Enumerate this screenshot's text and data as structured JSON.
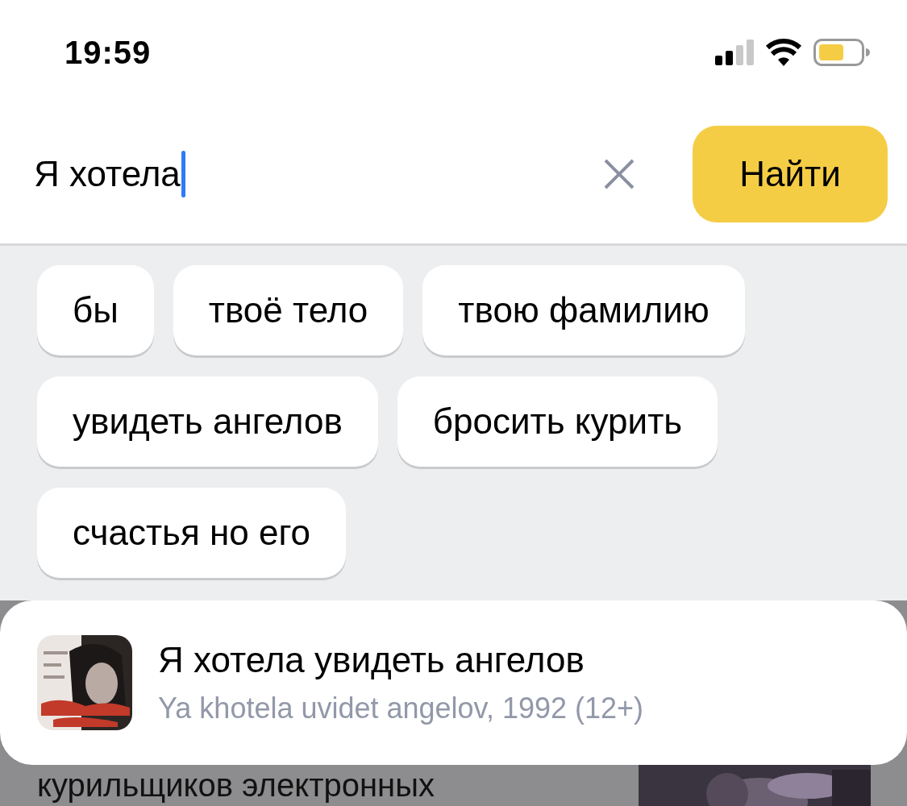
{
  "status_bar": {
    "time": "19:59"
  },
  "search": {
    "value": "Я хотела",
    "submit": "Найти"
  },
  "suggestions": [
    "бы",
    "твоё тело",
    "твою фамилию",
    "увидеть ангелов",
    "бросить курить",
    "счастья но его"
  ],
  "result": {
    "title": "Я хотела увидеть ангелов",
    "subtitle": "Ya khotela uvidet angelov, 1992 (12+)"
  },
  "background": {
    "text": "курильщиков электронных"
  }
}
